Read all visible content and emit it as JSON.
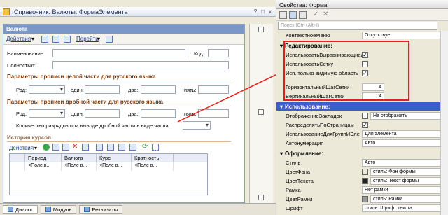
{
  "left_window": {
    "title": "Справочник. Валюты: ФормаЭлемента",
    "title_buttons": [
      "?",
      "□",
      "x"
    ],
    "form_header": "Валюта",
    "toolbar": {
      "actions": "Действия",
      "goto": "Перейти"
    },
    "fields": {
      "name_label": "Наименование:",
      "code_label": "Код:",
      "full_label": "Полностью:"
    },
    "section1": {
      "title": "Параметры прописи целой части для русского языка",
      "gender_label": "Род:",
      "one_label": "один:",
      "two_label": "два:",
      "five_label": "пять:"
    },
    "section2": {
      "title": "Параметры прописи дробной части для русского языка",
      "gender_label": "Род:",
      "one_label": "один:",
      "two_label": "два:",
      "five_label": "пять:",
      "digits_label": "Количество разрядов при выводе дробной части в виде числа:"
    },
    "history": {
      "title": "История курсов",
      "actions": "Действия",
      "columns": [
        "",
        "Период",
        "Валюта",
        "Курс",
        "Кратность"
      ],
      "row": [
        "",
        "<Поле в...",
        "<Поле в...",
        "<Поле в...",
        "<Поле в..."
      ]
    },
    "bottom_tabs": [
      "Диалог",
      "Модуль",
      "Реквизиты"
    ]
  },
  "right_window": {
    "title": "Свойства: Форма",
    "search_placeholder": "Поиск (Ctrl+Alt+I)",
    "context_menu": {
      "name": "КонтекстноеМеню",
      "value": "Отсутствует"
    },
    "edit_group": "Редактирование:",
    "edit_props": [
      {
        "name": "ИспользоватьВыравнивающиеЛинии",
        "checked": true
      },
      {
        "name": "ИспользоватьСетку",
        "checked": false
      },
      {
        "name": "Исп. только видимую область",
        "checked": true
      }
    ],
    "grid_steps": [
      {
        "name": "ГоризонтальныйШагСетки",
        "value": "4"
      },
      {
        "name": "ВертикальныйШагСетки",
        "value": "4"
      }
    ],
    "usage_group": "Использование:",
    "usage_props": [
      {
        "name": "ОтображениеЗакладок",
        "value": "Не отображать",
        "checkbox": true
      },
      {
        "name": "РаспределятьПоСтраницам",
        "value": "",
        "checkbox": true
      },
      {
        "name": "ИспользованиеДляГруппИЭле",
        "value": "Для элемента"
      },
      {
        "name": "Автонумерация",
        "value": "Авто"
      }
    ],
    "design_group": "Оформление:",
    "design_props": [
      {
        "name": "Стиль",
        "value": "Авто"
      },
      {
        "name": "ЦветФона",
        "value": "стиль: Фон формы",
        "swatch": "#ece9d8"
      },
      {
        "name": "ЦветТекста",
        "value": "стиль: Текст формы",
        "swatch": "#222222"
      },
      {
        "name": "Рамка",
        "value": "Нет рамки"
      },
      {
        "name": "ЦветРамки",
        "value": "стиль: Рамка",
        "swatch": "#999999"
      },
      {
        "name": "Шрифт",
        "value": "стиль: Шрифт текста"
      }
    ]
  },
  "colors": {
    "highlight_border": "#e81e1e",
    "selected_group": "#3a5fcd",
    "section_title": "#7a3a10"
  }
}
